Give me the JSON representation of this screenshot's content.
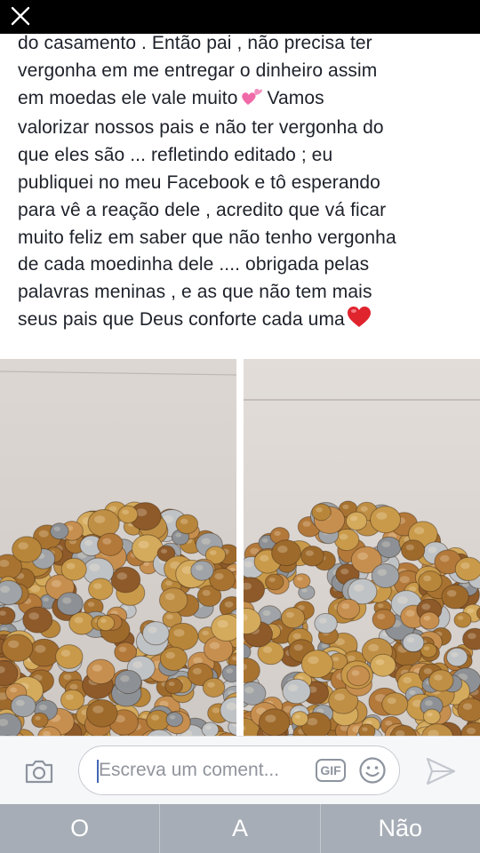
{
  "post": {
    "text": "do casamento . Então pai , não precisa ter\nvergonha em me entregar o dinheiro assim\nem moedas ele vale muito",
    "text2": " Vamos\nvalorizar nossos pais e não ter vergonha do\nque eles são ... refletindo editado ; eu\npubliquei no meu Facebook e tô esperando\npara vê a reação dele , acredito que vá ficar\nmuito feliz em saber que não tenho vergonha\nde cada moedinha dele .... obrigada pelas\npalavras meninas , e as que não tem mais\nseus pais que Deus conforte cada uma",
    "emoji_1": "two-hearts-icon",
    "emoji_2": "red-heart-icon"
  },
  "photos": [
    {
      "subject": "pile of coins on tiled floor"
    },
    {
      "subject": "pile of coins on tiled floor"
    }
  ],
  "comment_bar": {
    "placeholder": "Escreva um coment...",
    "gif_label": "GIF"
  },
  "answers": [
    "O",
    "A",
    "Não"
  ],
  "colors": {
    "topbar": "#000000",
    "text": "#1d2129",
    "answer_bar": "#a6adb6",
    "accent": "#4267b2",
    "heart": "#e0242e"
  }
}
